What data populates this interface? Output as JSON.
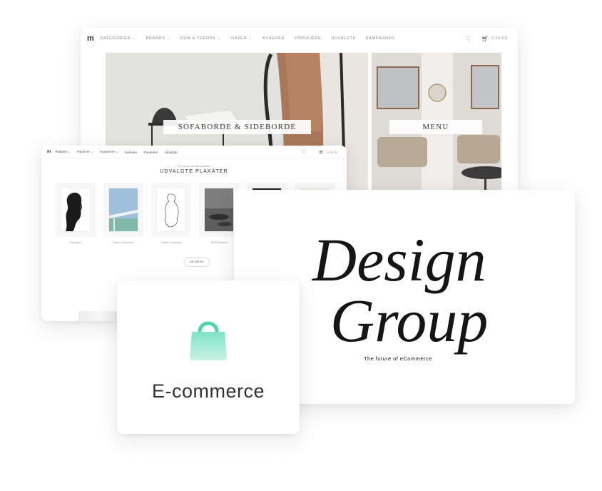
{
  "store_main": {
    "logo": "m",
    "nav": [
      "KATEGORIER ⌄",
      "BRANDS ⌄",
      "RUM & TRENDS ⌄",
      "GAVER ⌄",
      "NYHEDER",
      "POPULÆRE",
      "UDVALGTE",
      "KAMPAGNER"
    ],
    "cart_total": "0.00 KR",
    "hero_left_label": "SOFABORDE & SIDEBORDE",
    "hero_right_label": "MENU"
  },
  "store_posters": {
    "nav": [
      "Plakater ⌄",
      "Rammer ⌄",
      "Kunstnere ⌄",
      "Nyheder",
      "Populære",
      "Udvalgte"
    ],
    "cart_total": "0.00 kr",
    "subtitle": "En række smukke plakater",
    "section_title": "UDVALGTE PLAKATER",
    "posters": [
      "Paradisco",
      "Paper Collective",
      "Nellie Hamberg",
      "Print Factory"
    ],
    "see_more": "SE MERE"
  },
  "brand": {
    "line1": "Design",
    "line2": "Group",
    "tagline": "The future of eCommerce"
  },
  "ecom": {
    "label": "E-commerce",
    "icon": "shopping-bag-icon",
    "bag_color": "#7fe3c4"
  }
}
